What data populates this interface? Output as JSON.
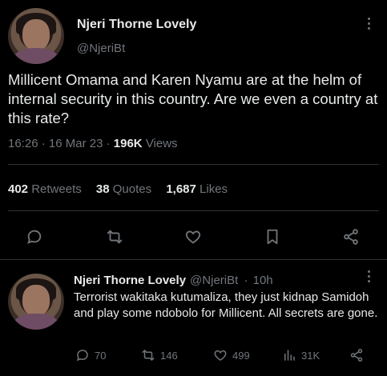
{
  "main_tweet": {
    "display_name": "Njeri Thorne Lovely",
    "handle": "@NjeriBt",
    "text": "Millicent Omama and Karen Nyamu are at the helm of internal security in this country. Are we even a country at this rate?",
    "time": "16:26",
    "date": "16 Mar 23",
    "views_count": "196K",
    "views_label": "Views",
    "retweets_count": "402",
    "retweets_label": "Retweets",
    "quotes_count": "38",
    "quotes_label": "Quotes",
    "likes_count": "1,687",
    "likes_label": "Likes",
    "separator": "·"
  },
  "reply": {
    "display_name": "Njeri Thorne Lovely",
    "handle": "@NjeriBt",
    "age": "10h",
    "separator": "·",
    "text": "Terrorist wakitaka kutumaliza, they just kidnap Samidoh and play some ndobolo for Millicent. All secrets are gone.",
    "replies": "70",
    "retweets": "146",
    "likes": "499",
    "views": "31K"
  },
  "colors": {
    "background": "#000000",
    "text": "#e7e9ea",
    "muted": "#71767b",
    "divider": "#2f3336"
  },
  "icons": [
    "more-icon",
    "reply-icon",
    "retweet-icon",
    "like-icon",
    "bookmark-icon",
    "share-icon",
    "views-icon"
  ]
}
